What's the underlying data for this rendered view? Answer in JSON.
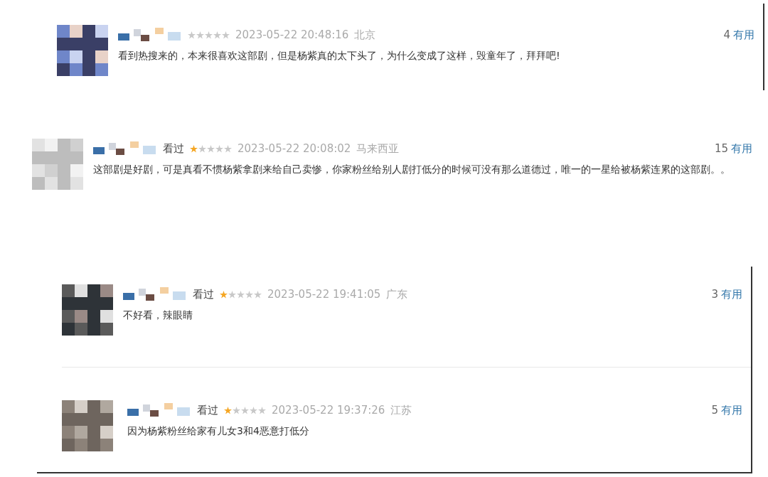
{
  "sections": [
    {
      "kind": "plain",
      "comments": [
        {
          "stars": 0,
          "time": "2023-05-22 20:48:16",
          "location": "北京",
          "votes": "4",
          "votes_label": "有用",
          "text": "看到热搜来的，本来很喜欢这部剧，但是杨紫真的太下头了，为什么变成了这样，毁童年了，拜拜吧!"
        }
      ]
    },
    {
      "kind": "open",
      "comments": [
        {
          "status": "看过",
          "stars": 1,
          "time": "2023-05-22 20:08:02",
          "location": "马来西亚",
          "votes": "15",
          "votes_label": "有用",
          "text": "这部剧是好剧，可是真看不惯杨紫拿剧来给自己卖惨，你家粉丝给别人剧打低分的时候可没有那么道德过，唯一的一星给被杨紫连累的这部剧。。"
        }
      ]
    },
    {
      "kind": "boxed",
      "comments": [
        {
          "status": "看过",
          "stars": 1,
          "time": "2023-05-22 19:41:05",
          "location": "广东",
          "votes": "3",
          "votes_label": "有用",
          "text": "不好看，辣眼睛"
        },
        {
          "status": "看过",
          "stars": 1,
          "time": "2023-05-22 19:37:26",
          "location": "江苏",
          "votes": "5",
          "votes_label": "有用",
          "text": "因为杨紫粉丝给家有儿女3和4恶意打低分"
        }
      ]
    }
  ]
}
